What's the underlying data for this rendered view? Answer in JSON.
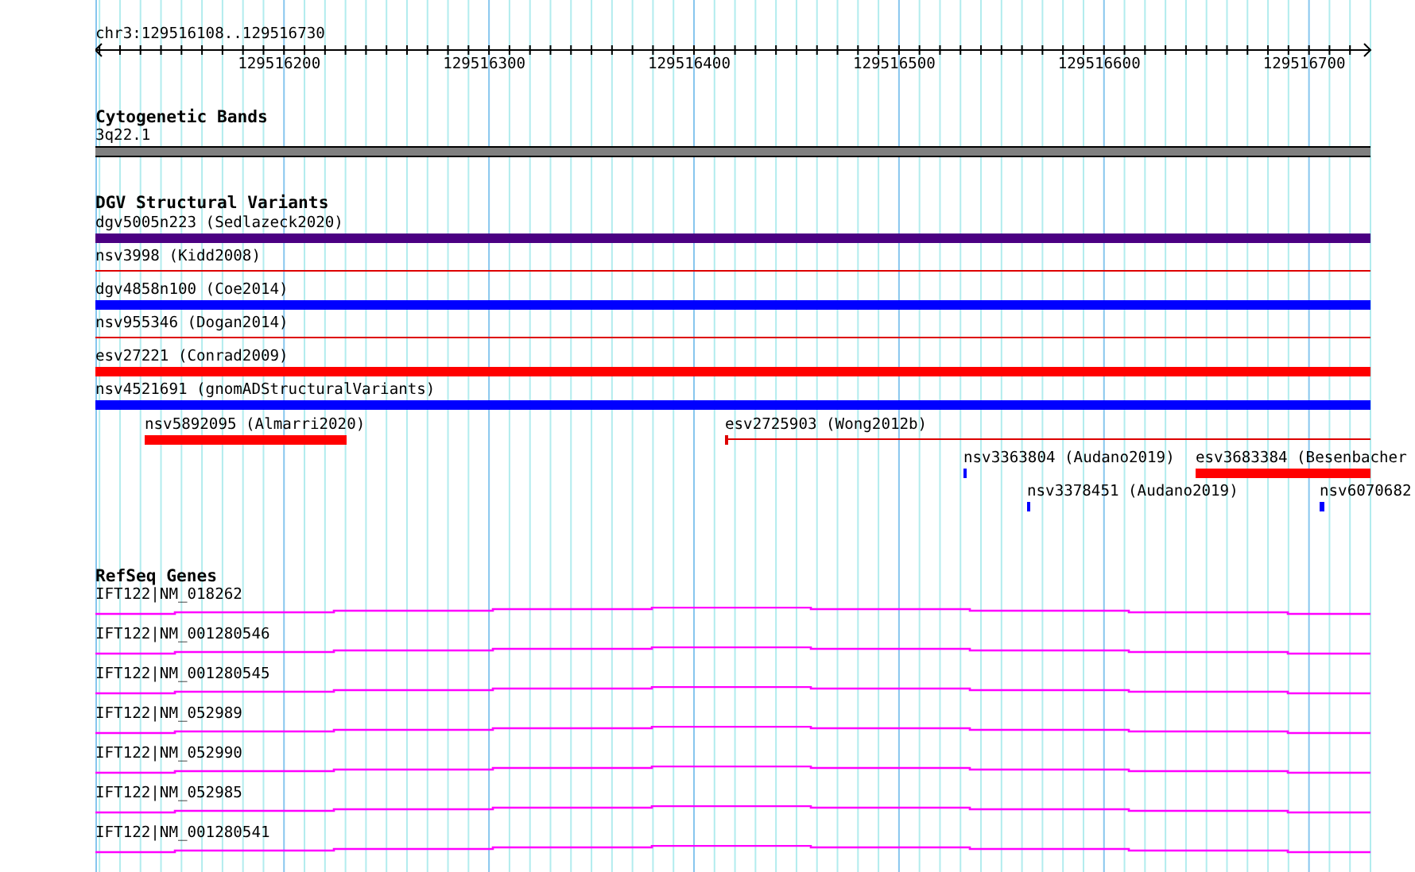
{
  "ruler": {
    "range_label": "chr3:129516108..129516730",
    "tick_labels": [
      "129516200",
      "129516300",
      "129516400",
      "129516500",
      "129516600",
      "129516700"
    ]
  },
  "cytogenetic_bands": {
    "title": "Cytogenetic Bands",
    "band": "3q22.1"
  },
  "dgv": {
    "title": "DGV Structural Variants",
    "variants": [
      {
        "label": "dgv5005n223 (Sedlazeck2020)",
        "kind": "bar",
        "color": "#4b0082"
      },
      {
        "label": "nsv3998 (Kidd2008)",
        "kind": "line",
        "color": "#dd0000"
      },
      {
        "label": "dgv4858n100 (Coe2014)",
        "kind": "bar",
        "color": "#0000ff"
      },
      {
        "label": "nsv955346 (Dogan2014)",
        "kind": "line",
        "color": "#dd0000"
      },
      {
        "label": "esv27221 (Conrad2009)",
        "kind": "bar",
        "color": "#ff0000"
      },
      {
        "label": "nsv4521691 (gnomADStructuralVariants)",
        "kind": "bar",
        "color": "#0000ff"
      },
      {
        "label": "nsv5892095 (Almarri2020)",
        "kind": "bar",
        "color": "#ff0000"
      },
      {
        "label": "esv2725903 (Wong2012b)",
        "kind": "line",
        "color": "#dd0000"
      },
      {
        "label": "nsv3363804 (Audano2019)",
        "kind": "bar",
        "color": "#0000ff"
      },
      {
        "label": "esv3683384 (Besenbacher",
        "kind": "bar",
        "color": "#ff0000"
      },
      {
        "label": "nsv3378451 (Audano2019)",
        "kind": "bar",
        "color": "#0000ff"
      },
      {
        "label": "nsv6070682",
        "kind": "bar",
        "color": "#0000ff"
      }
    ]
  },
  "refseq": {
    "title": "RefSeq Genes",
    "transcripts": [
      "IFT122|NM_018262",
      "IFT122|NM_001280546",
      "IFT122|NM_001280545",
      "IFT122|NM_052989",
      "IFT122|NM_052990",
      "IFT122|NM_052985",
      "IFT122|NM_001280541"
    ]
  }
}
